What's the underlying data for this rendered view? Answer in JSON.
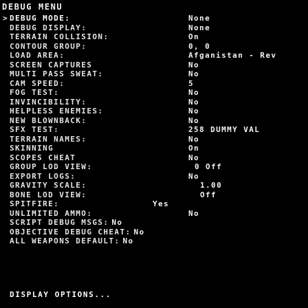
{
  "title": "DEBUG MENU",
  "marker": ">",
  "items": [
    {
      "label": "DEBUG MODE:",
      "value": "None"
    },
    {
      "label": "DEBUG DISPLAY:",
      "value": "None"
    },
    {
      "label": "TERRAIN COLLISION:",
      "value": "On"
    },
    {
      "label": "CONTOUR GROUP:",
      "value": "0, 0"
    },
    {
      "label": "LOAD AREA:",
      "value": "Afganistan - Rev"
    },
    {
      "label": "SCREEN CAPTURES",
      "value": "No"
    },
    {
      "label": "MULTI PASS SWEAT:",
      "value": "No"
    },
    {
      "label": "CAM SPEED:",
      "value": "5"
    },
    {
      "label": "FOG TEST:",
      "value": "No"
    },
    {
      "label": "INVINCIBILITY:",
      "value": "No"
    },
    {
      "label": "HELPLESS ENEMIES:",
      "value": "No"
    },
    {
      "label": "NEW BLOWNBACK:",
      "value": "No"
    },
    {
      "label": "SFX TEST:",
      "value": "258 DUMMY VAL"
    },
    {
      "label": "TERRAIN NAMES:",
      "value": "No"
    },
    {
      "label": "SKINNING",
      "value": "On"
    },
    {
      "label": "SCOPES CHEAT",
      "value": "No"
    },
    {
      "label": "GROUP LOD VIEW:",
      "value": "0 Off"
    },
    {
      "label": "EXPORT LOGS:",
      "value": "No"
    },
    {
      "label": "GRAVITY SCALE:",
      "value": "1.00"
    },
    {
      "label": "BONE LOD VIEW:",
      "value": "Off"
    },
    {
      "label": "SPITFIRE:",
      "value": "Yes"
    },
    {
      "label": "UNLIMITED AMMO:",
      "value": "No"
    },
    {
      "label": "SCRIPT DEBUG MSGS:",
      "value": "No"
    },
    {
      "label": "OBJECTIVE DEBUG CHEAT:",
      "value": "No"
    },
    {
      "label": "ALL WEAPONS DEFAULT:",
      "value": "No"
    }
  ],
  "footer": "DISPLAY OPTIONS...",
  "colors": {
    "background": "#000000",
    "text": "#e4e4e4",
    "highlight": "#ffffff"
  }
}
